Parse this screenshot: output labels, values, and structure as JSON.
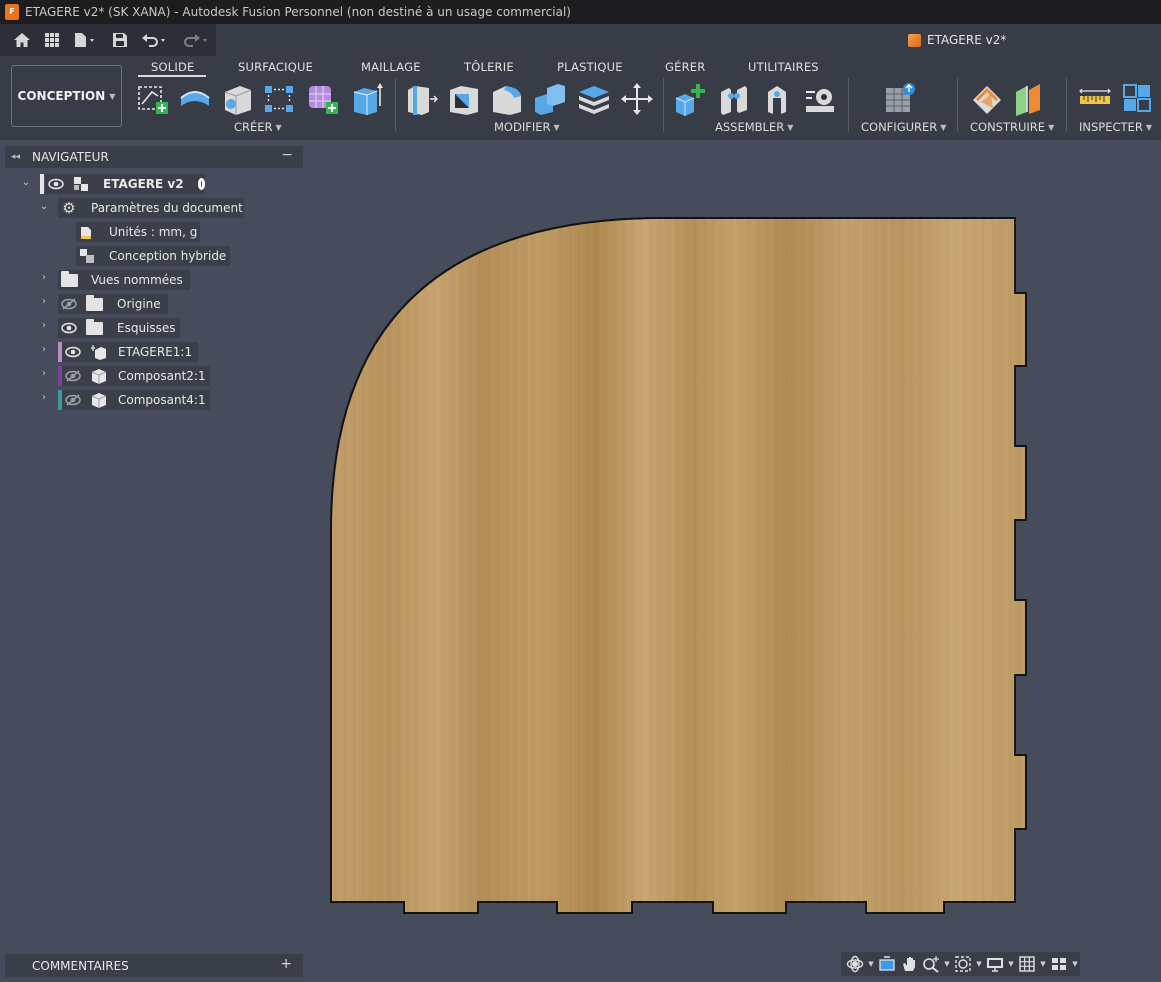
{
  "window": {
    "title": "ETAGERE v2* (SK XANA) - Autodesk Fusion Personnel (non destiné à un usage commercial)",
    "app_icon_text": "F"
  },
  "quick_access": {
    "icons": [
      "home-icon",
      "grid-icon",
      "file-icon",
      "save-icon",
      "undo-icon",
      "redo-icon"
    ]
  },
  "document_tab": {
    "label": "ETAGERE v2*"
  },
  "toolbar": {
    "workspace": "CONCEPTION",
    "tabs": [
      "SOLIDE",
      "SURFACIQUE",
      "MAILLAGE",
      "TÔLERIE",
      "PLASTIQUE",
      "GÉRER",
      "UTILITAIRES"
    ],
    "active_tab": "SOLIDE",
    "groups": {
      "creer": "CRÉER",
      "modifier": "MODIFIER",
      "assembler": "ASSEMBLER",
      "configurer": "CONFIGURER",
      "construire": "CONSTRUIRE",
      "inspecter": "INSPECTER"
    }
  },
  "navigator": {
    "title": "NAVIGATEUR",
    "root": "ETAGERE v2",
    "doc_settings": "Paramètres du document",
    "units": "Unités : mm, g",
    "hybrid": "Conception hybride",
    "named_views": "Vues nommées",
    "origin": "Origine",
    "sketches": "Esquisses",
    "components": [
      {
        "label": "ETAGERE1:1",
        "color": "#b98fc4",
        "visible": true
      },
      {
        "label": "Composant2:1",
        "color": "#7b3fa0",
        "visible": false
      },
      {
        "label": "Composant4:1",
        "color": "#3f9aa0",
        "visible": false
      }
    ]
  },
  "comments": {
    "label": "COMMENTAIRES"
  },
  "colors": {
    "canvas_bg": "#474c5c",
    "wood_light": "#c7a371",
    "wood_dark": "#a8844f",
    "accent_orange": "#e8741c"
  }
}
